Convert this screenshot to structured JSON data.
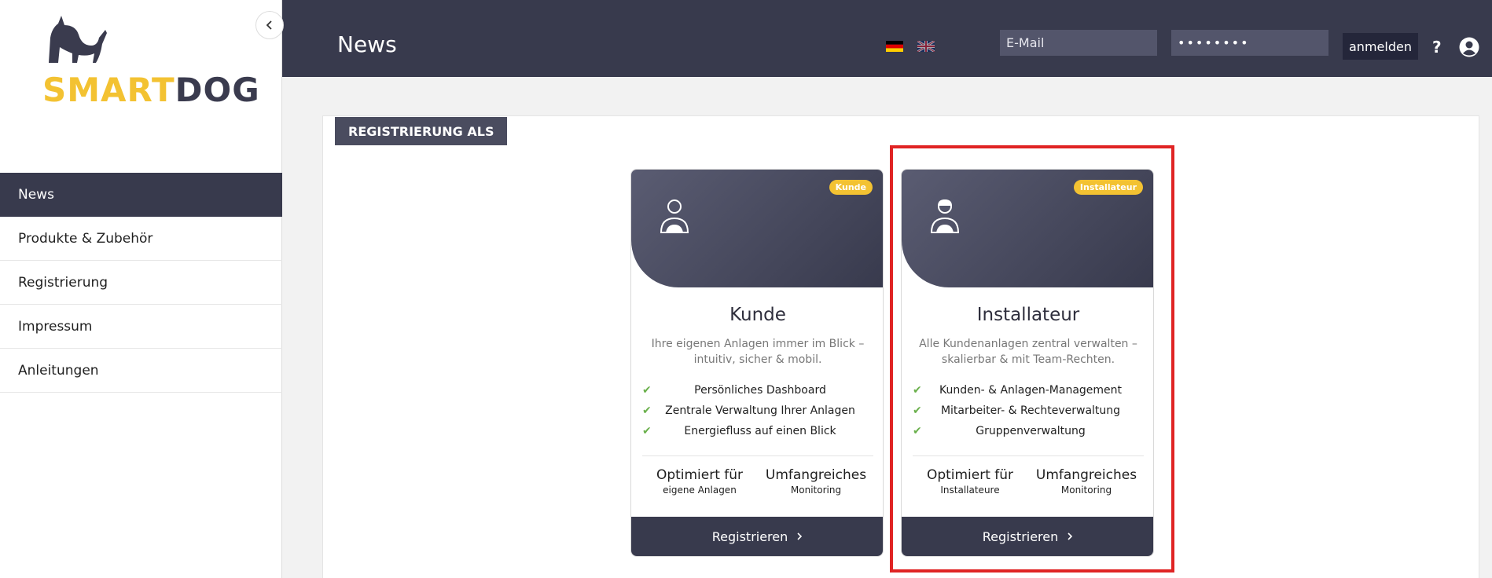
{
  "sidebar": {
    "logo": {
      "word1": "SMART",
      "word2": "DOG"
    },
    "collapse_icon": "chevron-left-icon",
    "items": [
      {
        "label": "News",
        "active": true
      },
      {
        "label": "Produkte & Zubehör",
        "active": false
      },
      {
        "label": "Registrierung",
        "active": false
      },
      {
        "label": "Impressum",
        "active": false
      },
      {
        "label": "Anleitungen",
        "active": false
      }
    ]
  },
  "header": {
    "title": "News",
    "languages": [
      "de-flag-icon",
      "uk-flag-icon"
    ],
    "email_placeholder": "E-Mail",
    "password_value": "••••••••",
    "login_label": "anmelden",
    "help_label": "?",
    "user_icon": "user-circle-icon"
  },
  "main": {
    "section_label": "REGISTRIERUNG ALS",
    "cards": [
      {
        "badge": "Kunde",
        "title": "Kunde",
        "description": "Ihre eigenen Anlagen immer im Blick – intuitiv, sicher & mobil.",
        "features": [
          "Persönliches Dashboard",
          "Zentrale Verwaltung Ihrer Anlagen",
          "Energiefluss auf einen Blick"
        ],
        "stats": [
          {
            "title": "Optimiert für",
            "sub": "eigene Anlagen"
          },
          {
            "title": "Umfangreiches",
            "sub": "Monitoring"
          }
        ],
        "button": "Registrieren"
      },
      {
        "badge": "Installateur",
        "title": "Installateur",
        "description": "Alle Kundenanlagen zentral verwalten – skalierbar & mit Team-Rechten.",
        "features": [
          "Kunden- & Anlagen-Management",
          "Mitarbeiter- & Rechteverwaltung",
          "Gruppenverwaltung"
        ],
        "stats": [
          {
            "title": "Optimiert für",
            "sub": "Installateure"
          },
          {
            "title": "Umfangreiches",
            "sub": "Monitoring"
          }
        ],
        "button": "Registrieren"
      }
    ]
  },
  "colors": {
    "brand_dark": "#383a4d",
    "brand_yellow": "#f3c232",
    "check_green": "#6ab04c",
    "highlight_red": "#e02424"
  }
}
